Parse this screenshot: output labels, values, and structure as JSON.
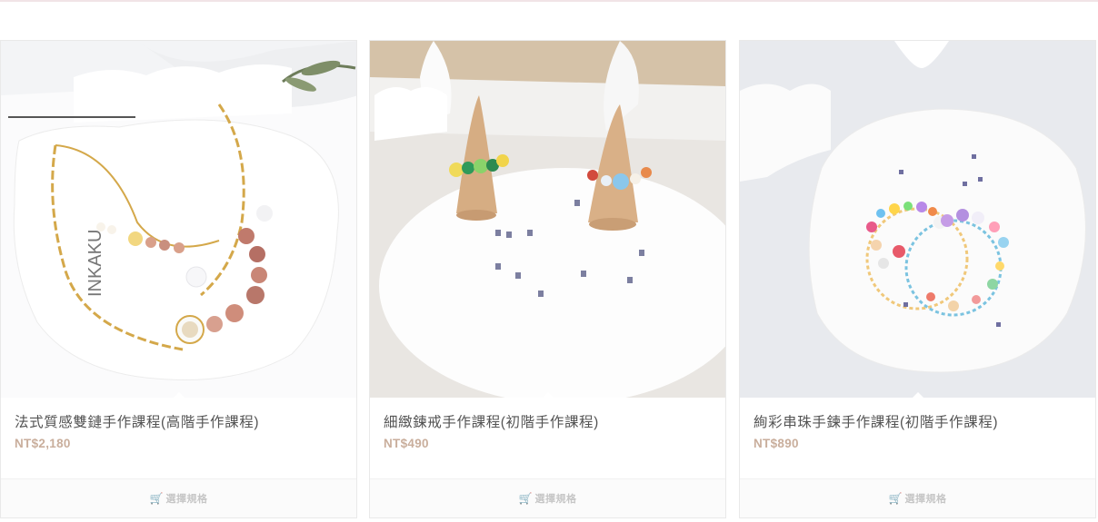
{
  "products": [
    {
      "title": "法式質感雙鏈手作課程(高階手作課程)",
      "price": "NT$2,180",
      "image_icon": "photo-bracelet-double-chain"
    },
    {
      "title": "細緻鍊戒手作課程(初階手作課程)",
      "price": "NT$490",
      "image_icon": "photo-bead-rings"
    },
    {
      "title": "絢彩串珠手鍊手作課程(初階手作課程)",
      "price": "NT$890",
      "image_icon": "photo-beaded-bracelets"
    }
  ],
  "select_button": {
    "label": "選擇規格",
    "icon": "cart-icon"
  },
  "colors": {
    "price": "#c9ae9c",
    "title": "#545454",
    "button_text": "#c6c6c6"
  }
}
